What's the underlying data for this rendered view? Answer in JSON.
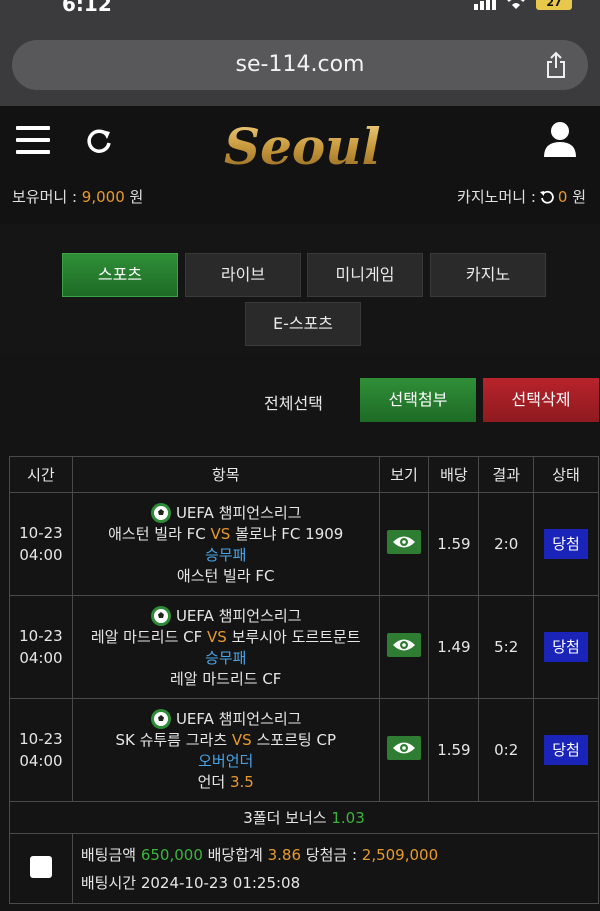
{
  "status_bar": {
    "time": "6:12",
    "battery": "27"
  },
  "browser": {
    "url": "se-114.com"
  },
  "header": {
    "logo_text": "Seoul",
    "money_label": "보유머니 : ",
    "money_value": "9,000",
    "money_unit": " 원",
    "casino_label": "카지노머니 : ",
    "casino_value": "0",
    "casino_unit": " 원"
  },
  "tabs": [
    {
      "label": "스포츠",
      "active": true
    },
    {
      "label": "라이브",
      "active": false
    },
    {
      "label": "미니게임",
      "active": false
    },
    {
      "label": "카지노",
      "active": false
    },
    {
      "label": "E-스포츠",
      "active": false
    }
  ],
  "actions": {
    "select_all": "전체선택",
    "attach": "선택첨부",
    "delete": "선택삭제"
  },
  "table": {
    "headers": [
      "시간",
      "항목",
      "보기",
      "배당",
      "결과",
      "상태"
    ],
    "rows": [
      {
        "date": "10-23",
        "time": "04:00",
        "league": "UEFA 챔피언스리그",
        "home": "애스턴 빌라 FC",
        "vs": "VS",
        "away": "볼로냐 FC 1909",
        "market": "승무패",
        "pick": "애스턴 빌라 FC",
        "pick_extra": "",
        "odds": "1.59",
        "result": "2:0",
        "status": "당첨"
      },
      {
        "date": "10-23",
        "time": "04:00",
        "league": "UEFA 챔피언스리그",
        "home": "레알 마드리드 CF",
        "vs": "VS",
        "away": "보루시아 도르트문트",
        "market": "승무패",
        "pick": "레알 마드리드 CF",
        "pick_extra": "",
        "odds": "1.49",
        "result": "5:2",
        "status": "당첨"
      },
      {
        "date": "10-23",
        "time": "04:00",
        "league": "UEFA 챔피언스리그",
        "home": "SK 슈투름 그라츠",
        "vs": "VS",
        "away": "스포르팅 CP",
        "market": "오버언더",
        "pick": "언더 ",
        "pick_extra": "3.5",
        "odds": "1.59",
        "result": "0:2",
        "status": "당첨"
      }
    ],
    "folder_bonus_label": "3폴더 보너스 ",
    "folder_bonus_value": "1.03",
    "summary": {
      "bet_amount_label": "배팅금액 ",
      "bet_amount": "650,000",
      "odds_total_label": " 배당합계 ",
      "odds_total": "3.86",
      "win_label": " 당첨금 : ",
      "win_amount": "2,509,000",
      "bet_time_label": "배팅시간 ",
      "bet_time": "2024-10-23 01:25:08"
    }
  },
  "colors": {
    "accent_green": "#2e8b36",
    "accent_red": "#a81f26",
    "badge_blue": "#1a24b8",
    "orange": "#e89a2c"
  }
}
